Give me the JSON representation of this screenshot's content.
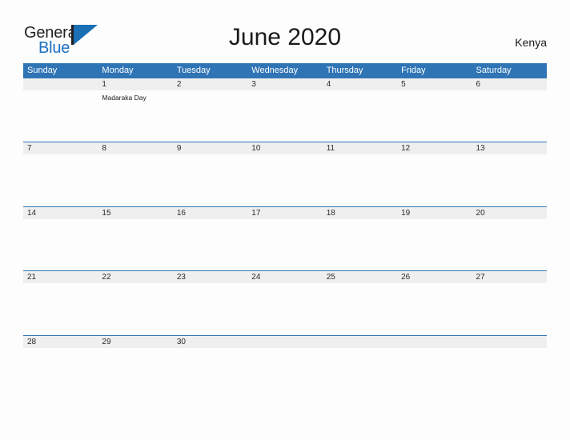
{
  "brand": {
    "name_part1": "General",
    "name_part2": "Blue",
    "mark": "triangle-flag-icon",
    "colors": {
      "dark": "#231f20",
      "blue": "#1d6fc0",
      "mark_blue": "#1a6fb5"
    }
  },
  "header": {
    "title": "June 2020",
    "region": "Kenya"
  },
  "theme": {
    "header_blue": "#2f74b5",
    "date_band_gray": "#efefef",
    "page_background": "#fdfdfd",
    "text_dark": "#1a1a1a"
  },
  "calendar": {
    "month": "June",
    "year": "2020",
    "weekdays": [
      "Sunday",
      "Monday",
      "Tuesday",
      "Wednesday",
      "Thursday",
      "Friday",
      "Saturday"
    ],
    "weeks": [
      {
        "days": [
          {
            "date": "",
            "events": []
          },
          {
            "date": "1",
            "events": [
              "Madaraka Day"
            ]
          },
          {
            "date": "2",
            "events": []
          },
          {
            "date": "3",
            "events": []
          },
          {
            "date": "4",
            "events": []
          },
          {
            "date": "5",
            "events": []
          },
          {
            "date": "6",
            "events": []
          }
        ]
      },
      {
        "days": [
          {
            "date": "7",
            "events": []
          },
          {
            "date": "8",
            "events": []
          },
          {
            "date": "9",
            "events": []
          },
          {
            "date": "10",
            "events": []
          },
          {
            "date": "11",
            "events": []
          },
          {
            "date": "12",
            "events": []
          },
          {
            "date": "13",
            "events": []
          }
        ]
      },
      {
        "days": [
          {
            "date": "14",
            "events": []
          },
          {
            "date": "15",
            "events": []
          },
          {
            "date": "16",
            "events": []
          },
          {
            "date": "17",
            "events": []
          },
          {
            "date": "18",
            "events": []
          },
          {
            "date": "19",
            "events": []
          },
          {
            "date": "20",
            "events": []
          }
        ]
      },
      {
        "days": [
          {
            "date": "21",
            "events": []
          },
          {
            "date": "22",
            "events": []
          },
          {
            "date": "23",
            "events": []
          },
          {
            "date": "24",
            "events": []
          },
          {
            "date": "25",
            "events": []
          },
          {
            "date": "26",
            "events": []
          },
          {
            "date": "27",
            "events": []
          }
        ]
      },
      {
        "days": [
          {
            "date": "28",
            "events": []
          },
          {
            "date": "29",
            "events": []
          },
          {
            "date": "30",
            "events": []
          },
          {
            "date": "",
            "events": []
          },
          {
            "date": "",
            "events": []
          },
          {
            "date": "",
            "events": []
          },
          {
            "date": "",
            "events": []
          }
        ]
      }
    ]
  }
}
